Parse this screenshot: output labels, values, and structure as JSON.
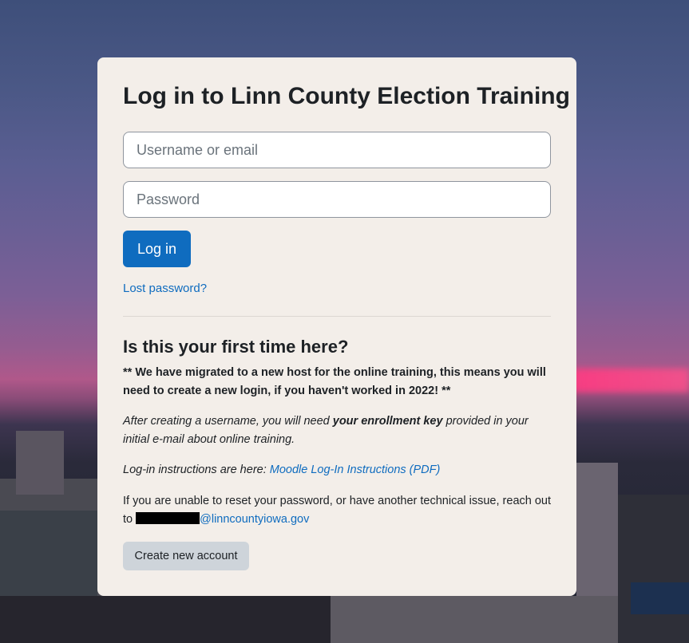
{
  "login": {
    "title": "Log in to Linn County Election Training",
    "username_placeholder": "Username or email",
    "password_placeholder": "Password",
    "login_button": "Log in",
    "lost_password": "Lost password?"
  },
  "first_time": {
    "heading": "Is this your first time here?",
    "migration_note": "** We have migrated to a new host for the online training, this means you will need to create a new login, if you haven't worked in 2022! **",
    "enrollment_prefix": "After creating a username, you will need ",
    "enrollment_bold": "your enrollment key",
    "enrollment_suffix": " provided in your initial e-mail about online training.",
    "instructions_prefix": "Log-in instructions are here: ",
    "instructions_link": "Moodle Log-In Instructions (PDF)",
    "support_text": "If you are unable to reset your password, or have another technical issue, reach out to ",
    "support_email_domain": "@linncountyiowa.gov",
    "create_account_button": "Create new account"
  },
  "colors": {
    "primary": "#0f6cbf",
    "card_background": "#f3eee9",
    "secondary_button": "#ced4da"
  }
}
